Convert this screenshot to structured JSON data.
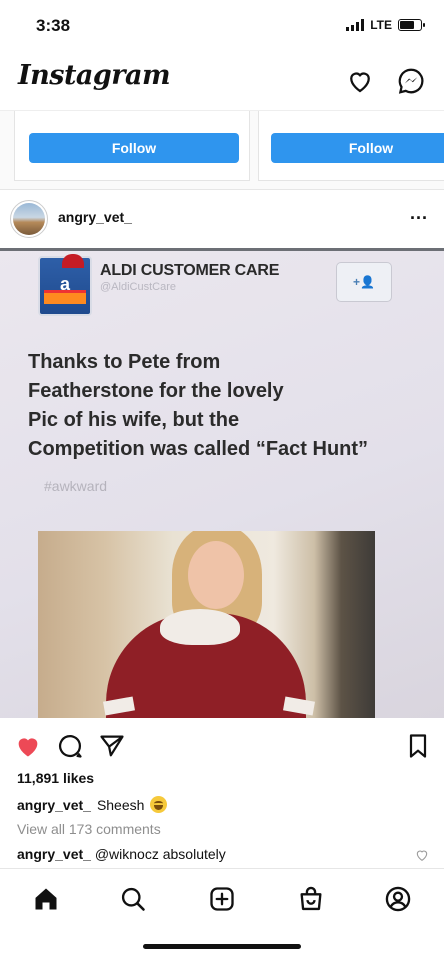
{
  "status_bar": {
    "time": "3:38",
    "network": "LTE"
  },
  "app": {
    "logo": "Instagram",
    "icons": [
      "heart-outline-icon",
      "messenger-icon"
    ]
  },
  "suggestions": {
    "follow_buttons": [
      "Follow",
      "Follow"
    ]
  },
  "post": {
    "username": "angry_vet_",
    "more": "...",
    "image": {
      "tweet_account": "ALDI CUSTOMER CARE",
      "tweet_handle": "@AldiCustCare",
      "tweet_lines": [
        "Thanks to Pete from",
        "Featherstone for the lovely",
        "Pic of his wife, but the",
        "Competition was called “Fact Hunt”"
      ],
      "tweet_tag": "#awkward"
    },
    "liked": true,
    "likes": "11,891 likes",
    "caption": {
      "user": "angry_vet_",
      "text": "Sheesh"
    },
    "view_comments": "View all 173 comments",
    "comment": {
      "user": "angry_vet_",
      "text": "@wiknocz absolutely"
    }
  },
  "bottom_nav": [
    "home-icon",
    "search-icon",
    "new-post-icon",
    "shop-icon",
    "profile-icon"
  ],
  "colors": {
    "accent": "#2f95ee",
    "like": "#ed4956",
    "text": "#111111",
    "muted": "#8e8e8e"
  }
}
